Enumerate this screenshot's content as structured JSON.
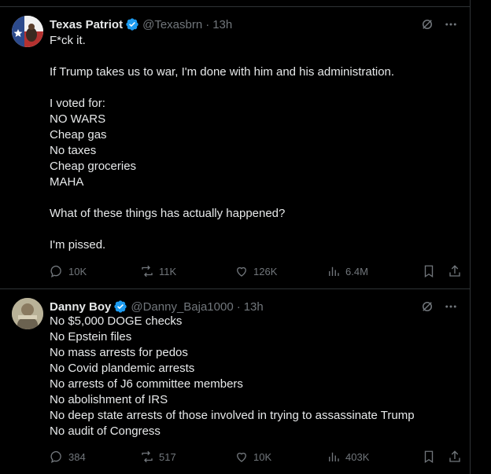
{
  "tweets": [
    {
      "name": "Texas Patriot",
      "handle": "@Texasbrn",
      "time": "13h",
      "lines": [
        "F*ck it.",
        "",
        "If Trump takes us to war, I'm done with him and his administration.",
        "",
        "I voted for:",
        "NO WARS",
        "Cheap gas",
        "No taxes",
        "Cheap groceries",
        "MAHA",
        "",
        "What of these things has actually happened?",
        "",
        "I'm pissed."
      ],
      "replies": "10K",
      "reposts": "11K",
      "likes": "126K",
      "views": "6.4M"
    },
    {
      "name": "Danny Boy",
      "handle": "@Danny_Baja1000",
      "time": "13h",
      "lines": [
        "No $5,000 DOGE checks",
        "No Epstein files",
        "No mass arrests for pedos",
        "No Covid plandemic arrests",
        "No arrests of J6 committee members",
        "No abolishment of IRS",
        "No deep state arrests of those involved in trying to assassinate Trump",
        "No audit of Congress"
      ],
      "replies": "384",
      "reposts": "517",
      "likes": "10K",
      "views": "403K"
    }
  ],
  "colors": {
    "background": "#000000",
    "text": "#e7e9ea",
    "muted": "#71767b",
    "verified": "#1d9bf0",
    "border": "#2f3336"
  },
  "icons": [
    "verified-badge-icon",
    "grok-icon",
    "more-icon",
    "reply-icon",
    "repost-icon",
    "like-icon",
    "views-icon",
    "bookmark-icon",
    "share-icon"
  ]
}
